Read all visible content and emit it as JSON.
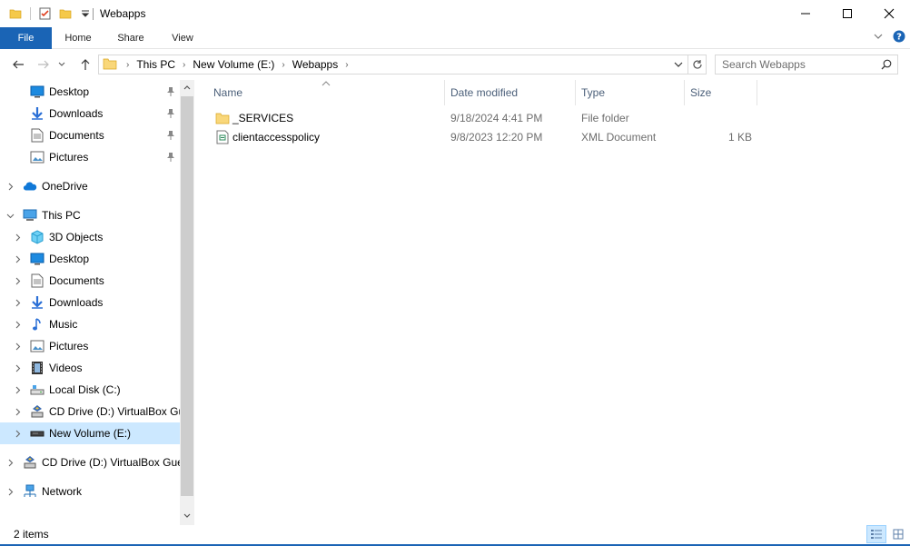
{
  "window": {
    "title": "Webapps"
  },
  "ribbon": {
    "tabs": [
      "File",
      "Home",
      "Share",
      "View"
    ]
  },
  "address": {
    "crumbs": [
      "This PC",
      "New Volume (E:)",
      "Webapps"
    ],
    "search_placeholder": "Search Webapps"
  },
  "nav": {
    "items": [
      {
        "label": "Desktop",
        "icon": "desktop-icon",
        "pinned": true
      },
      {
        "label": "Downloads",
        "icon": "downloads-icon",
        "pinned": true
      },
      {
        "label": "Documents",
        "icon": "documents-icon",
        "pinned": true
      },
      {
        "label": "Pictures",
        "icon": "pictures-icon",
        "pinned": true
      },
      {
        "label": "OneDrive",
        "icon": "onedrive-icon"
      },
      {
        "label": "This PC",
        "icon": "this-pc-icon"
      },
      {
        "label": "3D Objects",
        "icon": "3d-objects-icon"
      },
      {
        "label": "Desktop",
        "icon": "desktop-icon"
      },
      {
        "label": "Documents",
        "icon": "documents-icon"
      },
      {
        "label": "Downloads",
        "icon": "downloads-icon"
      },
      {
        "label": "Music",
        "icon": "music-icon"
      },
      {
        "label": "Pictures",
        "icon": "pictures-icon"
      },
      {
        "label": "Videos",
        "icon": "videos-icon"
      },
      {
        "label": "Local Disk (C:)",
        "icon": "local-disk-icon"
      },
      {
        "label": "CD Drive (D:) VirtualBox Gu",
        "icon": "cd-drive-icon"
      },
      {
        "label": "New Volume (E:)",
        "icon": "drive-icon",
        "selected": true
      },
      {
        "label": "CD Drive (D:) VirtualBox Gues",
        "icon": "cd-drive-icon"
      },
      {
        "label": "Network",
        "icon": "network-icon"
      }
    ]
  },
  "columns": {
    "name": "Name",
    "date": "Date modified",
    "type": "Type",
    "size": "Size"
  },
  "files": [
    {
      "name": "_SERVICES",
      "date": "9/18/2024 4:41 PM",
      "type": "File folder",
      "size": "",
      "icon": "folder-icon"
    },
    {
      "name": "clientaccesspolicy",
      "date": "9/8/2023 12:20 PM",
      "type": "XML Document",
      "size": "1 KB",
      "icon": "xml-file-icon"
    }
  ],
  "status": {
    "count": "2 items"
  },
  "colors": {
    "accent": "#1a64b5",
    "selection": "#cce8ff",
    "header_text": "#4c607a"
  }
}
